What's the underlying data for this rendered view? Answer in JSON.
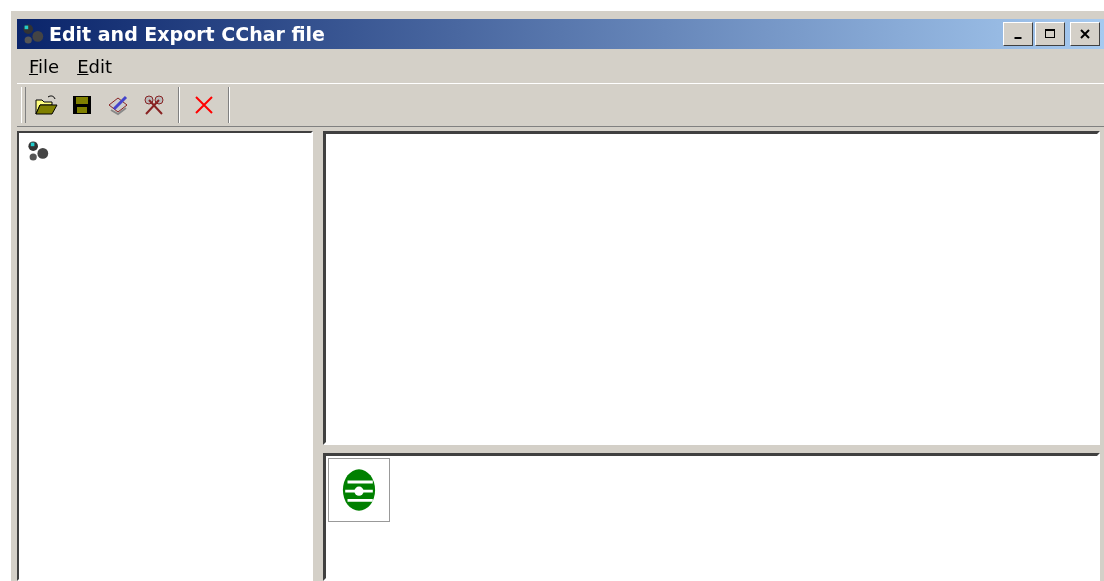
{
  "window": {
    "title": "Edit and Export CChar file"
  },
  "menu": [
    {
      "label": "File"
    },
    {
      "label": "Edit"
    }
  ],
  "toolbar": [
    {
      "kind": "open"
    },
    {
      "kind": "save"
    },
    {
      "kind": "edit"
    },
    {
      "kind": "export"
    },
    {
      "kind": "separator"
    },
    {
      "kind": "delete"
    }
  ],
  "tree": {
    "items": [
      {
        "kind": "root"
      }
    ]
  },
  "lower_pane": {
    "items": [
      {
        "kind": "char"
      }
    ]
  }
}
